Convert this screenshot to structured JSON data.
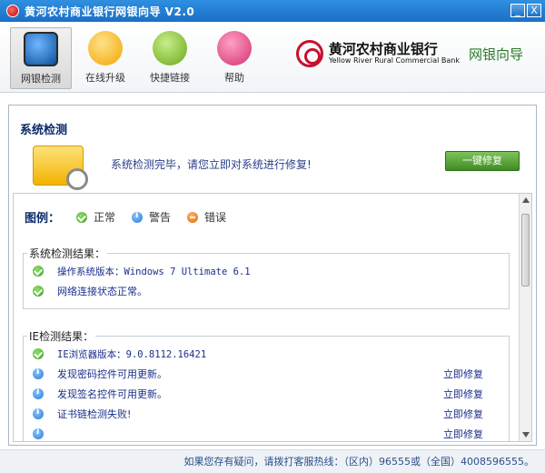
{
  "window": {
    "title": "黄河农村商业银行网银向导 V2.0",
    "min_label": "_",
    "close_label": "X"
  },
  "toolbar": {
    "items": [
      {
        "label": "网银检测",
        "icon": "monitor-check-icon"
      },
      {
        "label": "在线升级",
        "icon": "upload-icon"
      },
      {
        "label": "快捷链接",
        "icon": "link-icon"
      },
      {
        "label": "帮助",
        "icon": "help-icon"
      }
    ]
  },
  "brand": {
    "name_cn": "黄河农村商业银行",
    "name_en": "Yellow River Rural Commercial Bank",
    "tagline": "网银向导",
    "color": "#c8102e"
  },
  "check": {
    "title": "系统检测",
    "message": "系统检测完毕，请您立即对系统进行修复!",
    "repair_button": "一键修复"
  },
  "legend": {
    "title": "图例：",
    "ok": "正常",
    "warn": "警告",
    "err": "错误"
  },
  "system_results": {
    "title": "系统检测结果：",
    "rows": [
      {
        "status": "ok",
        "text": "操作系统版本：Windows 7 Ultimate 6.1"
      },
      {
        "status": "ok",
        "text": "网络连接状态正常。"
      }
    ]
  },
  "ie_results": {
    "title": "IE检测结果：",
    "rows": [
      {
        "status": "ok",
        "text": "IE浏览器版本：9.0.8112.16421",
        "action": ""
      },
      {
        "status": "warn",
        "text": "发现密码控件可用更新。",
        "action": "立即修复"
      },
      {
        "status": "warn",
        "text": "发现签名控件可用更新。",
        "action": "立即修复"
      },
      {
        "status": "warn",
        "text": "证书链检测失败!",
        "action": "立即修复"
      },
      {
        "status": "warn",
        "text": "",
        "action": "立即修复"
      }
    ]
  },
  "footer": {
    "text": "如果您存有疑问，请拨打客服热线：（区内）96555或（全国）4008596555。"
  }
}
